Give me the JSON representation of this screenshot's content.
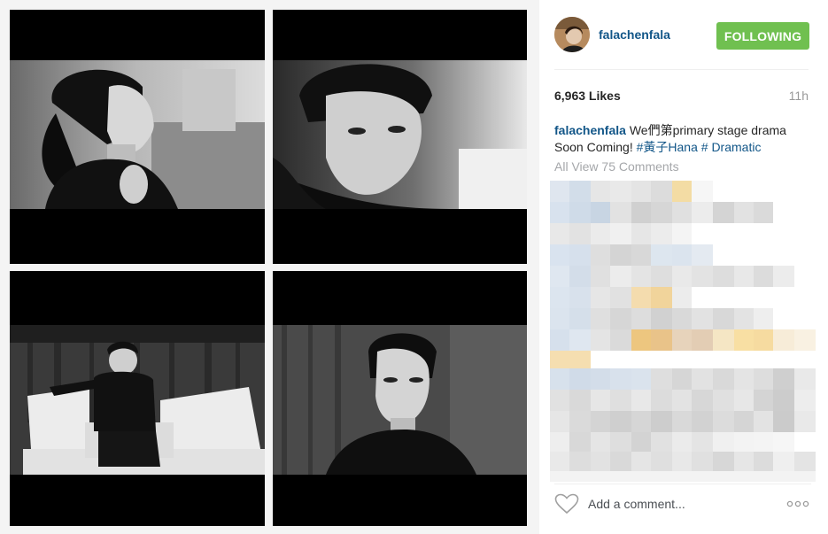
{
  "post": {
    "username": "falachenfala",
    "follow_label": "FOLLOWING",
    "likes": "6,963 Likes",
    "timestamp": "11h",
    "caption": {
      "username": "falachenfala",
      "text_part1": " We們第primary stage drama Soon Coming! ",
      "hashtag1": "#黃子Hana",
      "text_part2": " ",
      "hashtag2": "# Dramatic"
    },
    "view_comments": "All View 75 Comments",
    "comment_placeholder": "Add a comment...",
    "icons": {
      "like": "heart-outline-icon",
      "more": "ellipsis-icon"
    },
    "colors": {
      "follow_button": "#70c050",
      "username_link": "#125688",
      "muted_text": "#999999"
    }
  },
  "photo_panels": [
    {
      "id": "top-left",
      "subject": "woman in turtleneck profile"
    },
    {
      "id": "top-right",
      "subject": "man close-up"
    },
    {
      "id": "bottom-left",
      "subject": "man on white sofa"
    },
    {
      "id": "bottom-right",
      "subject": "woman portrait"
    }
  ]
}
